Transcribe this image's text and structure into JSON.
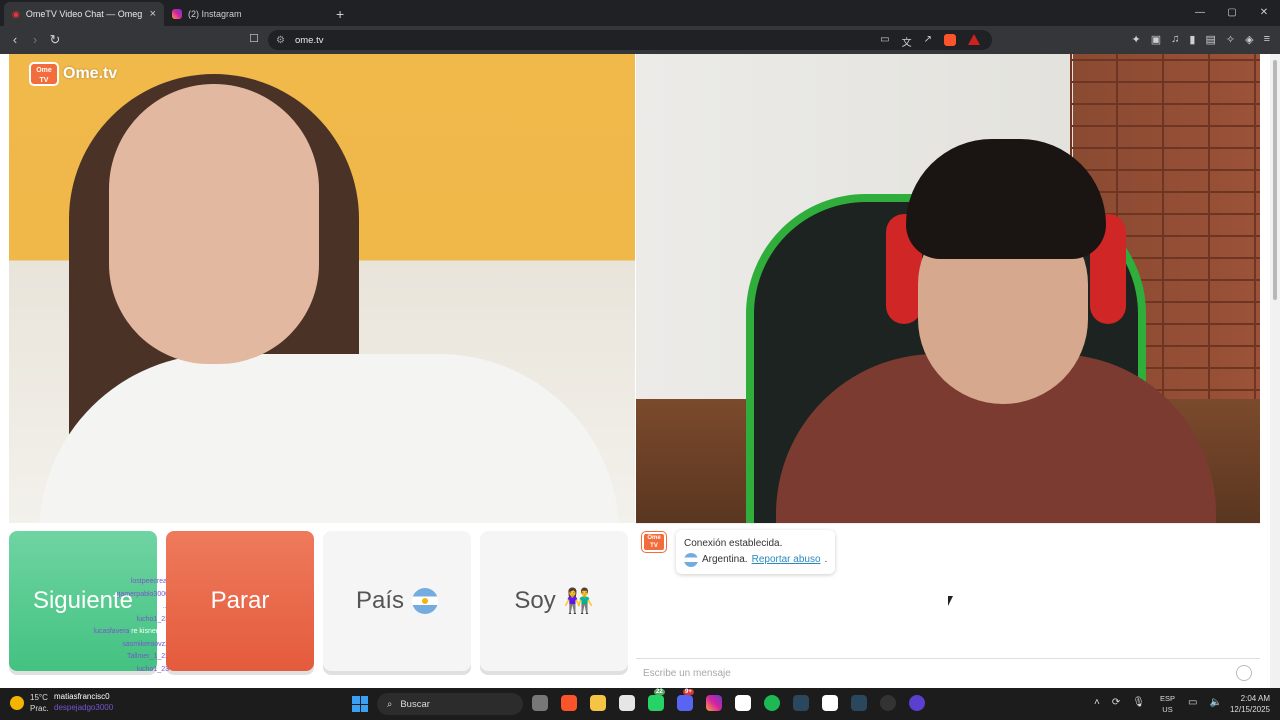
{
  "browser": {
    "tabs": [
      {
        "title": "OmeTV Video Chat — Omeg",
        "active": true
      },
      {
        "title": "(2) Instagram",
        "active": false
      }
    ],
    "new_tab": "+",
    "url": "ome.tv",
    "window_controls": [
      "—",
      "▢",
      "✕"
    ]
  },
  "site": {
    "logo_text": "Ome.tv",
    "logo_badge": "Ome TV",
    "buttons": {
      "next": "Siguiente",
      "stop": "Parar",
      "country": "País",
      "gender": "Soy",
      "gender_emoji": "👫"
    },
    "overlay_names": [
      "lostpeecreat",
      "gamerpablo3000",
      "…",
      "lucho1_23",
      "lucasfavera",
      "sasmikeroovz2",
      "Tallmer_1_22",
      "lucho1_23",
      "alkamas"
    ],
    "overlay_note": "re kisnerista",
    "chat": {
      "badge": "Ome TV",
      "system_message": "Conexión establecida.",
      "country_label": "Argentina.",
      "report_link": "Reportar abuso",
      "trailing": ".",
      "input_placeholder": "Escribe un mensaje"
    }
  },
  "taskbar": {
    "temperature": "15°C",
    "weather_note": "Prac.",
    "overlay_user": "matiasfrancisc0",
    "overlay_user2": "despejadgo3000",
    "search_placeholder": "Buscar",
    "badge_whatsapp": "22",
    "badge_discord": "9+",
    "lang_line1": "ESP",
    "lang_line2": "US",
    "time": "2:04 AM",
    "date": "12/15/2025"
  },
  "colors": {
    "next_button": "#43c281",
    "stop_button": "#e45b3c",
    "brand": "#f36c3b",
    "report_link": "#2a8abf"
  }
}
